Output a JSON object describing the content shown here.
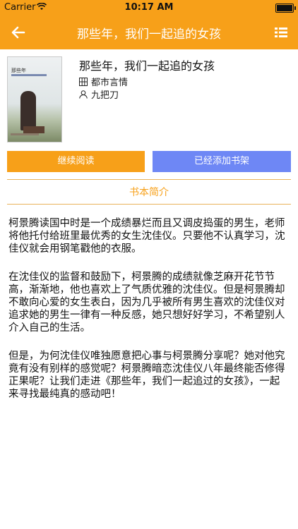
{
  "status_bar": {
    "carrier": "Carrier",
    "time": "10:17 AM"
  },
  "nav": {
    "title": "那些年，我们一起追的女孩"
  },
  "book": {
    "title": "那些年，我们一起追的女孩",
    "genre": "都市言情",
    "author": "九把刀",
    "cover_caption": "那些年"
  },
  "buttons": {
    "continue_reading": "继续阅读",
    "added_to_shelf": "已经添加书架"
  },
  "section": {
    "title": "书本简介"
  },
  "intro": {
    "paragraphs": [
      "柯景腾读国中时是一个成绩暴烂而且又调皮捣蛋的男生，老师将他托付给班里最优秀的女生沈佳仪。只要他不认真学习，沈佳仪就会用钢笔戳他的衣服。",
      "在沈佳仪的监督和鼓励下，柯景腾的成绩就像芝麻开花节节高，渐渐地，他也喜欢上了气质优雅的沈佳仪。但是柯景腾却不敢向心爱的女生表白，因为几乎被所有男生喜欢的沈佳仪对追求她的男生一律有一种反感，她只想好好学习，不希望别人介入自己的生活。",
      "但是，为何沈佳仪唯独愿意把心事与柯景腾分享呢？她对他究竟有没有别样的感觉呢？柯景腾暗恋沈佳仪八年最终能否修得正果呢？让我们走进《那些年，我们一起追过的女孩》，一起来寻找最纯真的感动吧！"
    ]
  },
  "colors": {
    "accent": "#f7a019",
    "secondary_button": "#6e87f5"
  },
  "icons": {
    "back": "arrow-left-icon",
    "list": "list-icon",
    "genre": "grid-icon",
    "author": "person-icon"
  }
}
